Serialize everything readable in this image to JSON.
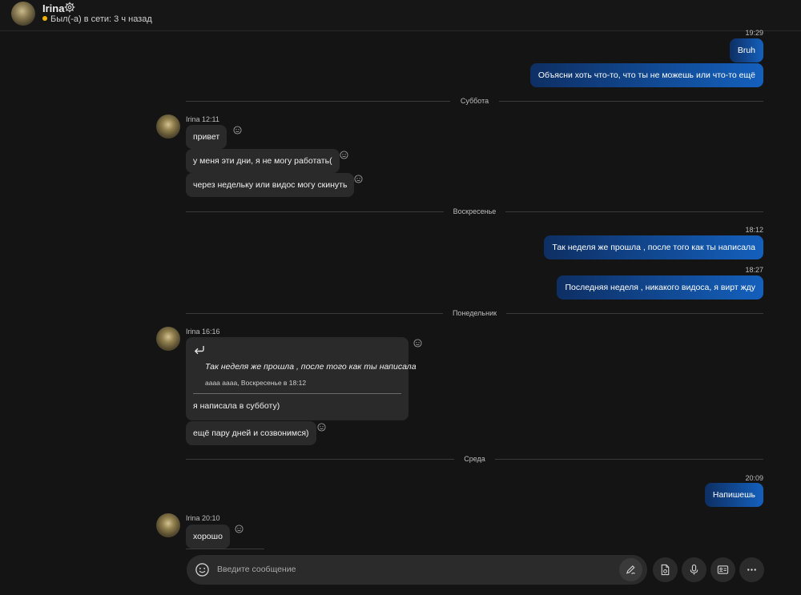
{
  "header": {
    "name": "Irina",
    "status": "Был(-а) в сети: 3 ч назад"
  },
  "messages": {
    "t1": "19:29",
    "m1": "Bruh",
    "m2": "Объясни хоть что-то, что ты не можешь или что-то ещё",
    "day1": "Суббота",
    "s1": "Irina 12:11",
    "m3": "привет",
    "m4": "у меня эти дни, я не могу работать(",
    "m5": "через недельку или видос могу скинуть",
    "day2": "Воскресенье",
    "t2": "18:12",
    "m6": "Так неделя же прошла , после того как ты написала",
    "t3": "18:27",
    "m7": "Последняя неделя , никакого видоса, я вирт жду",
    "day3": "Понедельник",
    "s2": "Irina 16:16",
    "quote_text": "Так неделя же прошла , после того как ты написала",
    "quote_meta": "аааа аааа, Воскресенье в 18:12",
    "m8": "я написала в субботу)",
    "m9": "ещё пару дней и созвонимся)",
    "day4": "Среда",
    "t4": "20:09",
    "m10": "Напишешь",
    "s3": "Irina 20:10",
    "m11": "хорошо"
  },
  "composer": {
    "placeholder": "Введите сообщение"
  },
  "icons": {
    "settings": "gear-icon",
    "emoji": "smiley-icon",
    "reaction": "add-reaction-icon",
    "reply": "reply-arrow-icon",
    "pen": "pen-icon",
    "file": "file-icon",
    "mic": "microphone-icon",
    "card": "contact-card-icon",
    "more": "more-icon"
  },
  "colors": {
    "background": "#141414",
    "bubble_in": "#2a2a2a",
    "bubble_out_start": "#0e2f63",
    "bubble_out_end": "#1460bd",
    "status_dot": "#f0b400"
  }
}
